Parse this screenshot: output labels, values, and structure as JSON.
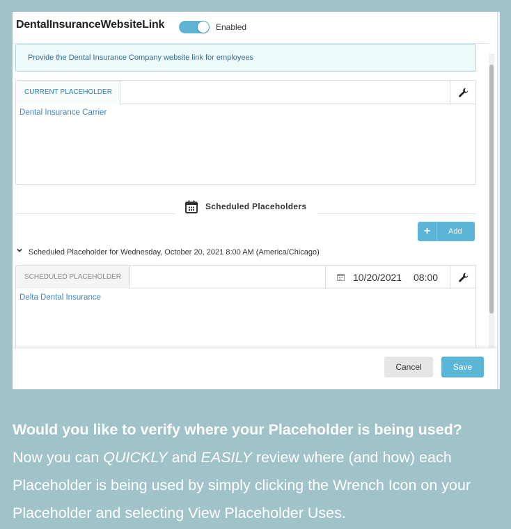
{
  "dialog": {
    "title": "DentalInsuranceWebsiteLink",
    "toggle": {
      "label": "Enabled",
      "on": true
    },
    "info_text": "Provide the Dental Insurance Company website link for employees",
    "current": {
      "tab_label": "CURRENT PLACEHOLDER",
      "value": "Dental Insurance Carrier",
      "wrench_icon": "wrench-icon"
    },
    "scheduled_section": {
      "title": "Scheduled Placeholders",
      "icon": "calendar-icon"
    },
    "add_button": {
      "icon": "plus-icon",
      "label": "Add"
    },
    "schedule": {
      "title": "Scheduled Placeholder for Wednesday, October 20, 2021 8:00 AM (America/Chicago)",
      "tab_label": "SCHEDULED PLACEHOLDER",
      "date": "10/20/2021",
      "time": "08:00",
      "value": "Delta Dental Insurance"
    },
    "footer": {
      "cancel_label": "Cancel",
      "save_label": "Save"
    }
  },
  "caption": {
    "headline": "Would you like to verify where your Placeholder is being used?",
    "p1": "Now you can ",
    "em1": "QUICKLY",
    "p2": " and ",
    "em2": "EASILY",
    "p3": " review where (and how) each Placeholder is being used by simply clicking the Wrench Icon on your Placeholder and selecting View Placeholder Uses."
  },
  "colors": {
    "page_background": "#9fc3c8",
    "accent": "#5bb5d6",
    "link": "#3a86c4"
  }
}
